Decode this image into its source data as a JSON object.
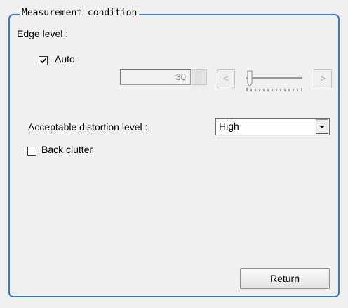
{
  "panel": {
    "title": "Measurement condition"
  },
  "edge_level": {
    "label": "Edge level :",
    "auto_label": "Auto",
    "auto_checked": true,
    "value": "30",
    "decrease_label": "<",
    "increase_label": ">"
  },
  "distortion": {
    "label": "Acceptable distortion level :",
    "selected": "High"
  },
  "back_clutter": {
    "label": "Back clutter",
    "checked": false
  },
  "actions": {
    "return_label": "Return"
  },
  "colors": {
    "group_border": "#3c78c4",
    "background": "#f0f0f0"
  }
}
